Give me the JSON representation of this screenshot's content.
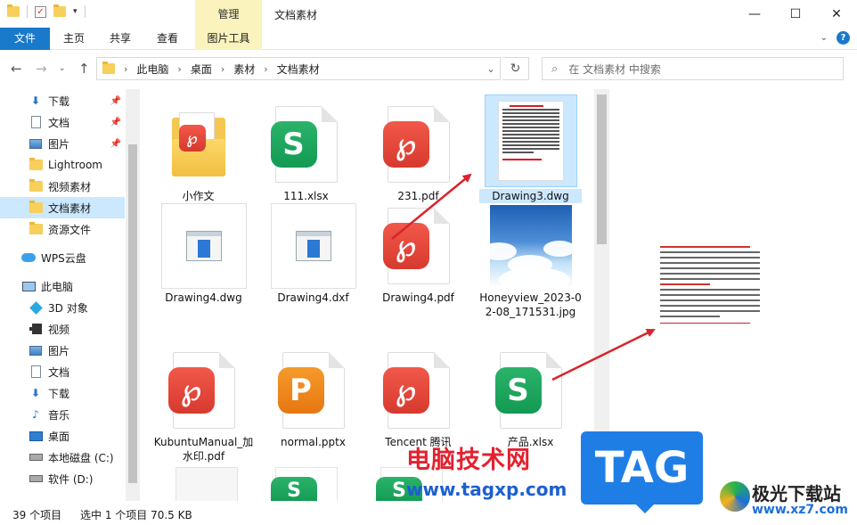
{
  "window": {
    "title": "文档素材",
    "manage_tab": "管理"
  },
  "ribbon": {
    "tabs": [
      "文件",
      "主页",
      "共享",
      "查看",
      "图片工具"
    ],
    "help": "?"
  },
  "address": {
    "crumbs": [
      "此电脑",
      "桌面",
      "素材",
      "文档素材"
    ],
    "search_placeholder": "在 文档素材 中搜索"
  },
  "sidebar": {
    "items": [
      {
        "label": "下载",
        "icon": "download-icon",
        "pinned": true
      },
      {
        "label": "文档",
        "icon": "document-icon",
        "pinned": true
      },
      {
        "label": "图片",
        "icon": "picture-icon",
        "pinned": true
      },
      {
        "label": "Lightroom",
        "icon": "folder-icon",
        "pinned": false
      },
      {
        "label": "视频素材",
        "icon": "folder-icon",
        "pinned": false
      },
      {
        "label": "文档素材",
        "icon": "folder-icon",
        "pinned": false,
        "selected": true
      },
      {
        "label": "资源文件",
        "icon": "folder-icon",
        "pinned": false
      },
      {
        "label": "WPS云盘",
        "icon": "cloud-icon",
        "pinned": false
      },
      {
        "label": "此电脑",
        "icon": "computer-icon",
        "pinned": false
      },
      {
        "label": "3D 对象",
        "icon": "3d-objects-icon",
        "pinned": false
      },
      {
        "label": "视频",
        "icon": "video-icon",
        "pinned": false
      },
      {
        "label": "图片",
        "icon": "picture-icon",
        "pinned": false
      },
      {
        "label": "文档",
        "icon": "document-icon",
        "pinned": false
      },
      {
        "label": "下载",
        "icon": "download-icon",
        "pinned": false
      },
      {
        "label": "音乐",
        "icon": "music-icon",
        "pinned": false
      },
      {
        "label": "桌面",
        "icon": "desktop-icon",
        "pinned": false
      },
      {
        "label": "本地磁盘 (C:)",
        "icon": "disk-icon",
        "pinned": false
      },
      {
        "label": "软件 (D:)",
        "icon": "disk-icon",
        "pinned": false
      }
    ]
  },
  "files": [
    {
      "name": "小作文",
      "type": "folder"
    },
    {
      "name": "111.xlsx",
      "type": "xlsx"
    },
    {
      "name": "231.pdf",
      "type": "pdf"
    },
    {
      "name": "Drawing3.dwg",
      "type": "dwg-preview",
      "selected": true
    },
    {
      "name": "Drawing4.dwg",
      "type": "dwg"
    },
    {
      "name": "Drawing4.dxf",
      "type": "dwg"
    },
    {
      "name": "Drawing4.pdf",
      "type": "pdf"
    },
    {
      "name": "Honeyview_2023-02-08_171531.jpg",
      "type": "jpg"
    },
    {
      "name": "KubuntuManual_加水印.pdf",
      "type": "pdf"
    },
    {
      "name": "normal.pptx",
      "type": "pptx"
    },
    {
      "name": "Tencent 腾讯",
      "type": "pdf"
    },
    {
      "name": "产品.xlsx",
      "type": "xlsx"
    }
  ],
  "status": {
    "count": "39 个项目",
    "selected": "选中 1 个项目  70.5 KB"
  },
  "watermarks": {
    "site_name": "电脑技术网",
    "site_url": "www.tagxp.com",
    "tag": "TAG",
    "jg_name": "极光下载站",
    "jg_url": "www.xz7.com"
  },
  "colors": {
    "accent": "#1979ca",
    "selection": "#cce8ff",
    "manage_tab": "#fbf3bd",
    "arrow": "#d9232d"
  }
}
